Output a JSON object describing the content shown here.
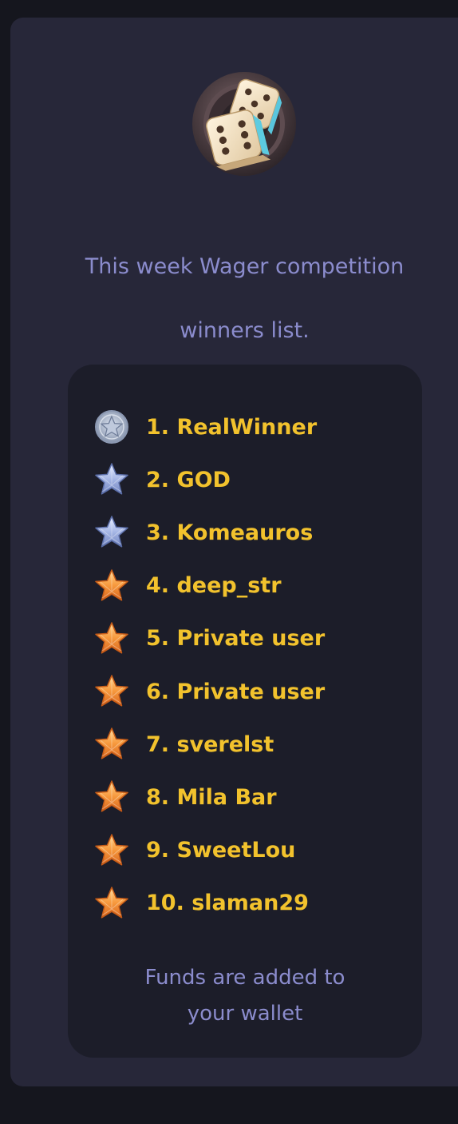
{
  "logo": {
    "icon": "dice-icon"
  },
  "heading": {
    "line1": "This week Wager competition",
    "line2": "winners list."
  },
  "winners": [
    {
      "label": "1. RealWinner",
      "badge": "silver-star-medal"
    },
    {
      "label": "2. GOD",
      "badge": "silver-star"
    },
    {
      "label": "3. Komeauros",
      "badge": "silver-star"
    },
    {
      "label": "4. deep_str",
      "badge": "gold-star"
    },
    {
      "label": "5. Private user",
      "badge": "gold-star"
    },
    {
      "label": "6. Private user",
      "badge": "gold-star"
    },
    {
      "label": "7. sverelst",
      "badge": "gold-star"
    },
    {
      "label": "8. Mila Bar",
      "badge": "gold-star"
    },
    {
      "label": "9. SweetLou",
      "badge": "gold-star"
    },
    {
      "label": "10. slaman29",
      "badge": "gold-star"
    }
  ],
  "footer": {
    "line1": "Funds are added to",
    "line2": "your wallet"
  },
  "colors": {
    "page_background": "#15161e",
    "card_background": "#272739",
    "panel_background": "#1c1d29",
    "heading_text": "#8b8ccd",
    "winner_text": "#f2c22d",
    "gold_star": "#f28a2c",
    "silver_star": "#9fb0e0"
  }
}
